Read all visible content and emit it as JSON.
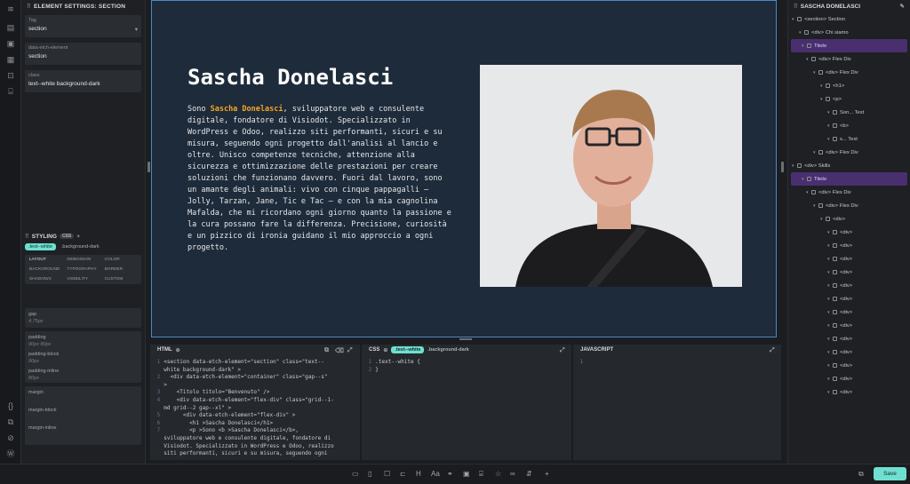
{
  "left_rail": {
    "icons": [
      "logo-icon",
      "pages-icon",
      "image-icon",
      "layout-icon",
      "lock-icon",
      "code-bracket-icon",
      "curly-braces-icon",
      "components-icon",
      "eye-off-icon",
      "wordpress-icon"
    ]
  },
  "element_settings": {
    "title": "ELEMENT SETTINGS: SECTION",
    "fields": [
      {
        "label": "Tag",
        "value": "section"
      },
      {
        "label": "data-etch-element",
        "value": "section"
      },
      {
        "label": "class",
        "value": "text--white background-dark"
      }
    ]
  },
  "styling": {
    "title": "STYLING",
    "badge": "CSS",
    "chips": [
      ".text--white",
      ".background-dark"
    ],
    "tabs": [
      "LAYOUT",
      "DIMENSION",
      "COLOR",
      "BACKGROUND",
      "TYPOGRAPHY",
      "BORDER",
      "SHADOWS",
      "VISIBILITY",
      "CUSTOM"
    ],
    "props": [
      {
        "label": "gap",
        "value": "4.75px"
      },
      {
        "label": "padding",
        "value": "90px 80px"
      },
      {
        "label": "padding-block",
        "value": "90px"
      },
      {
        "label": "padding-inline",
        "value": "80px"
      },
      {
        "label": "margin",
        "value": ""
      },
      {
        "label": "margin-block",
        "value": ""
      },
      {
        "label": "margin-inline",
        "value": ""
      }
    ]
  },
  "canvas": {
    "heading": "Sascha Donelasci",
    "intro": "Sono ",
    "name": "Sascha Donelasci",
    "body": ", sviluppatore web e consulente digitale, fondatore di Visiodot. Specializzato in WordPress e Odoo, realizzo siti performanti, sicuri e su misura, seguendo ogni progetto dall'analisi al lancio e oltre. Unisco competenze tecniche, attenzione alla sicurezza e ottimizzazione delle prestazioni per creare soluzioni che funzionano davvero. Fuori dal lavoro, sono un amante degli animali: vivo con cinque pappagalli – Jolly, Tarzan, Jane, Tic e Tac – e con la mia cagnolina Mafalda, che mi ricordano ogni giorno quanto la passione e la cura possano fare la differenza. Precisione, curiosità e un pizzico di ironia guidano il mio approccio a ogni progetto."
  },
  "structure": {
    "title": "SASCHA DONELASCI",
    "rows": [
      {
        "text": "<section> Section",
        "depth": 0,
        "style": "sel"
      },
      {
        "text": "<div> Chi siamo",
        "depth": 1
      },
      {
        "text": "Titolo",
        "depth": 1,
        "style": "hl"
      },
      {
        "text": "<div> Flex Div",
        "depth": 2
      },
      {
        "text": "<div> Flex Div",
        "depth": 3
      },
      {
        "text": "<h1>",
        "depth": 4
      },
      {
        "text": "<p>",
        "depth": 4
      },
      {
        "text": "Son... Text",
        "depth": 5
      },
      {
        "text": "<b>",
        "depth": 5
      },
      {
        "text": "s... Text",
        "depth": 5
      },
      {
        "text": "<div> Flex Div",
        "depth": 3
      },
      {
        "text": "<div> Skills",
        "depth": 0
      },
      {
        "text": "Titolo",
        "depth": 1,
        "style": "hl"
      },
      {
        "text": "<div> Flex Div",
        "depth": 2
      },
      {
        "text": "<div> Flex Div",
        "depth": 3
      },
      {
        "text": "<div>",
        "depth": 4
      },
      {
        "text": "<div>",
        "depth": 5
      },
      {
        "text": "<div>",
        "depth": 5
      },
      {
        "text": "<div>",
        "depth": 5
      },
      {
        "text": "<div>",
        "depth": 5
      },
      {
        "text": "<div>",
        "depth": 5
      },
      {
        "text": "<div>",
        "depth": 5
      },
      {
        "text": "<div>",
        "depth": 5
      },
      {
        "text": "<div>",
        "depth": 5
      },
      {
        "text": "<div>",
        "depth": 5
      },
      {
        "text": "<div>",
        "depth": 5
      },
      {
        "text": "<div>",
        "depth": 5
      },
      {
        "text": "<div>",
        "depth": 5
      },
      {
        "text": "<div>",
        "depth": 5
      }
    ]
  },
  "html_pane": {
    "title": "HTML",
    "lines": [
      [
        "1",
        "<section data-etch-element=\"section\" class=\"text--"
      ],
      [
        "",
        "white background-dark\" >"
      ],
      [
        "2",
        "  <div data-etch-element=\"container\" class=\"gap--s\""
      ],
      [
        "",
        ">"
      ],
      [
        "3",
        "    <Titolo titolo=\"Benvenuto\" />"
      ],
      [
        "4",
        "    <div data-etch-element=\"flex-div\" class=\"grid--1-"
      ],
      [
        "",
        "md grid--2 gap--xl\" >"
      ],
      [
        "5",
        "      <div data-etch-element=\"flex-div\" >"
      ],
      [
        "6",
        "        <h1 >Sascha Donelasci</h1>"
      ],
      [
        "7",
        "        <p >Sono <b >Sascha Donelasci</b>,"
      ],
      [
        "",
        "sviluppatore web e consulente digitale, fondatore di"
      ],
      [
        "",
        "Visiodot. Specializzato in WordPress e Odoo, realizzo"
      ],
      [
        "",
        "siti performanti, sicuri e su misura, seguendo ogni"
      ]
    ]
  },
  "css_pane": {
    "title": "CSS",
    "chips": [
      ".text--white",
      ".background-dark"
    ],
    "lines": [
      [
        "1",
        ".text--white {"
      ],
      [
        "2",
        "}"
      ]
    ]
  },
  "js_pane": {
    "title": "JAVASCRIPT",
    "lines": [
      [
        "1",
        ""
      ]
    ]
  },
  "bottom": {
    "save_label": "Save"
  }
}
